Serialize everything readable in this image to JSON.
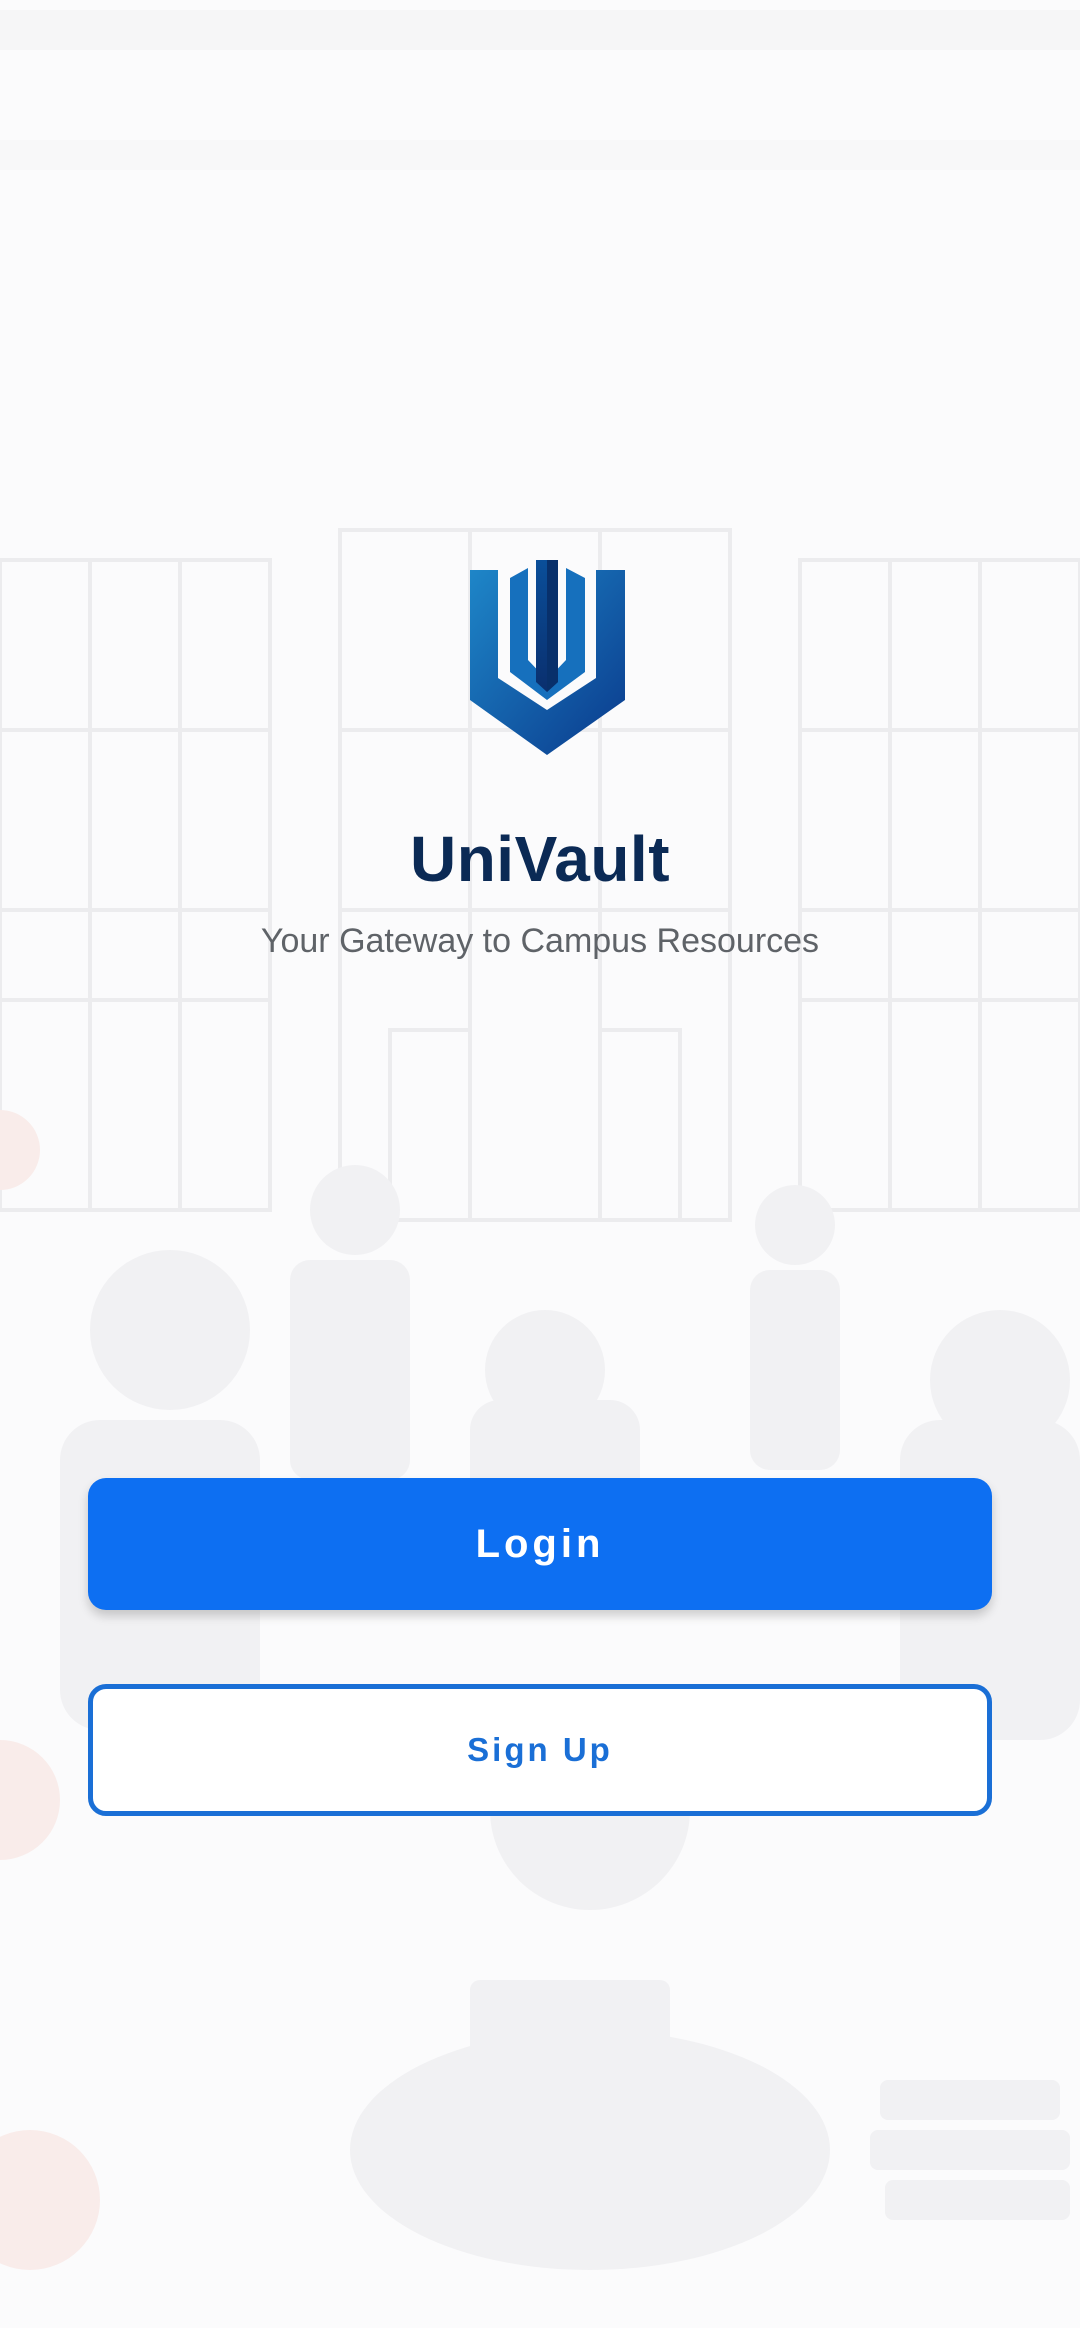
{
  "app": {
    "title": "UniVault",
    "subtitle": "Your Gateway to Campus Resources"
  },
  "actions": {
    "login_label": "Login",
    "signup_label": "Sign Up"
  },
  "icons": {
    "logo": "univault-shield-logo"
  },
  "colors": {
    "primary": "#0d6ff2",
    "title": "#0b2a55",
    "subtitle": "#5f6368",
    "outline": "#1a6fd6"
  }
}
